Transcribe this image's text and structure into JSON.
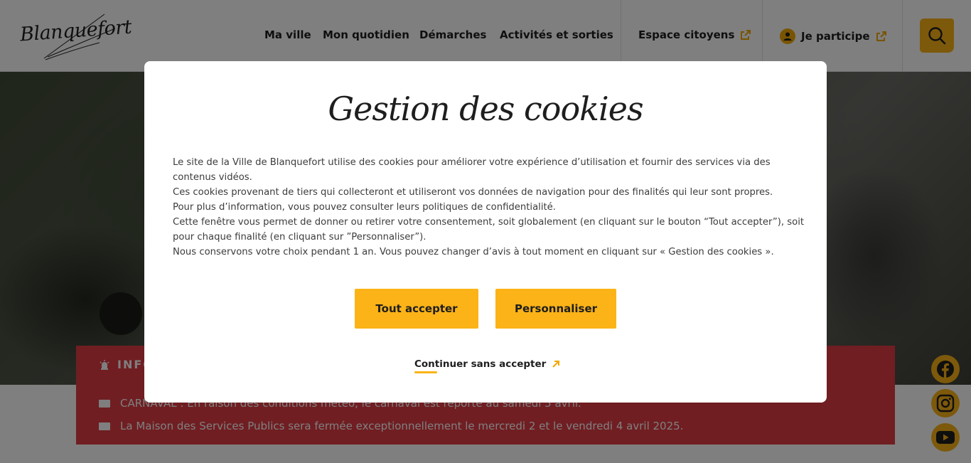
{
  "header": {
    "logo_text": "Blanquefort",
    "nav": [
      "Ma ville",
      "Mon quotidien",
      "Démarches",
      "Activités et sorties"
    ],
    "espace_citoyens": "Espace citoyens",
    "je_participe": "Je participe",
    "icons": {
      "external": "external-link-icon",
      "user": "user-icon",
      "search": "search-icon"
    }
  },
  "info": {
    "title": "INFO",
    "items": [
      "CARNAVAL : En raison des conditions météo, le carnaval est reporté au samedi 5 avril.",
      "La Maison des Services Publics sera fermée exceptionnellement le mercredi 2 et le vendredi 4 avril 2025."
    ]
  },
  "social": [
    "facebook-icon",
    "instagram-icon",
    "youtube-icon"
  ],
  "modal": {
    "title": "Gestion des cookies",
    "paragraphs": [
      "Le site de la Ville de Blanquefort utilise des cookies pour améliorer votre expérience d’utilisation et fournir des services via des contenus vidéos.",
      "Ces cookies provenant de tiers qui collecteront et utiliseront vos données de navigation pour des finalités qui leur sont propres.",
      "Pour plus d’information, vous pouvez consulter leurs politiques de confidentialité.",
      "Cette fenêtre vous permet de donner ou retirer votre consentement, soit globalement (en cliquant sur le bouton “Tout accepter”), soit pour chaque finalité (en cliquant sur ”Personnaliser”).",
      "Nous conservons votre choix pendant 1 an. Vous pouvez changer d’avis à tout moment en cliquant sur « Gestion des cookies »."
    ],
    "accept_label": "Tout accepter",
    "customize_label": "Personnaliser",
    "continue_label": "Continuer sans accepter"
  },
  "colors": {
    "accent_yellow": "#fbb317",
    "info_red": "#e03c45",
    "overlay": "rgba(0,0,0,0.5)",
    "text_dark": "#1e1e1e"
  }
}
